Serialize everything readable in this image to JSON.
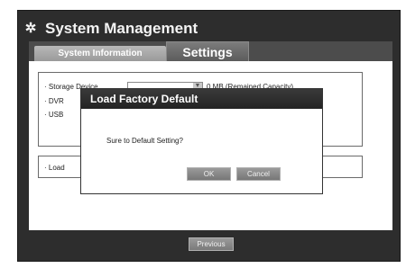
{
  "title": "System Management",
  "tabs": [
    {
      "label": "System Information"
    },
    {
      "label": "Settings"
    }
  ],
  "settings": {
    "storage_label": "· Storage Device",
    "storage_capacity": "0 MB (Remained Capacity)",
    "dvr_label": "· DVR",
    "usb_label": "· USB",
    "load_label": "· Load"
  },
  "footer": {
    "previous_label": "Previous"
  },
  "dialog": {
    "title": "Load Factory Default",
    "message": "Sure to Default Setting?",
    "ok_label": "OK",
    "cancel_label": "Cancel"
  }
}
